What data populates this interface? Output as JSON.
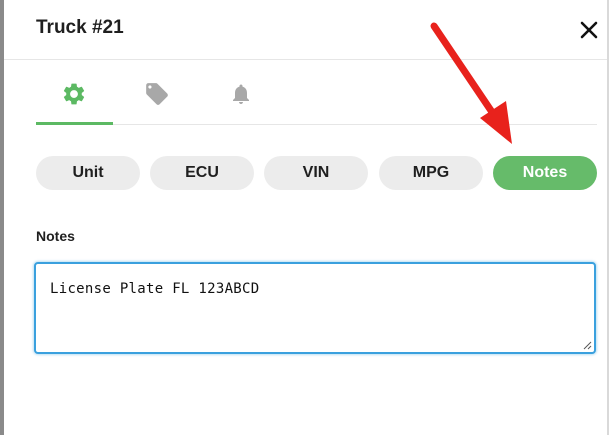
{
  "window": {
    "title": "Truck #21",
    "close_icon": "close-icon"
  },
  "tabs": [
    {
      "name": "settings",
      "icon": "gear-icon",
      "active": true
    },
    {
      "name": "tags",
      "icon": "tag-icon",
      "active": false
    },
    {
      "name": "alerts",
      "icon": "bell-icon",
      "active": false
    }
  ],
  "sub_tabs": [
    {
      "label": "Unit",
      "active": false
    },
    {
      "label": "ECU",
      "active": false
    },
    {
      "label": "VIN",
      "active": false
    },
    {
      "label": "MPG",
      "active": false
    },
    {
      "label": "Notes",
      "active": true
    }
  ],
  "notes": {
    "label": "Notes",
    "value": "License Plate FL 123ABCD"
  },
  "colors": {
    "accent": "#66bb6a",
    "active_tab_icon": "#5cb963",
    "inactive_icon": "#a8a8a8",
    "pill_inactive": "#ececec",
    "focus_border": "#3aa0de",
    "annotation_arrow": "#e8221c"
  }
}
